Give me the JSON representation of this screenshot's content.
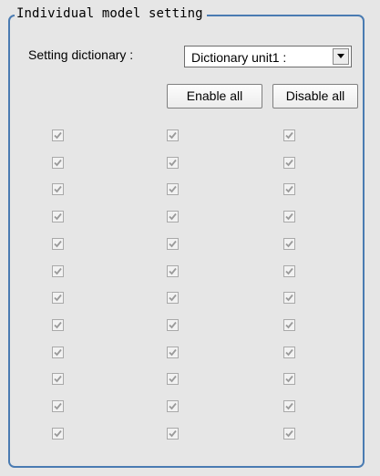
{
  "group": {
    "title": "Individual model setting"
  },
  "setting_dictionary": {
    "label": "Setting dictionary :",
    "selected": "Dictionary unit1 :"
  },
  "buttons": {
    "enable_all": "Enable all",
    "disable_all": "Disable all"
  },
  "checkbox_grid": {
    "columns": 3,
    "rows": 12,
    "checked": true,
    "enabled": false
  },
  "icons": {
    "dropdown": "chevron-down-icon",
    "check": "checkmark-icon"
  },
  "colors": {
    "background": "#e6e6e6",
    "group_border": "#4a7bb2",
    "checkbox_border": "#a9a9a9",
    "checkmark": "#9a9a9a"
  }
}
